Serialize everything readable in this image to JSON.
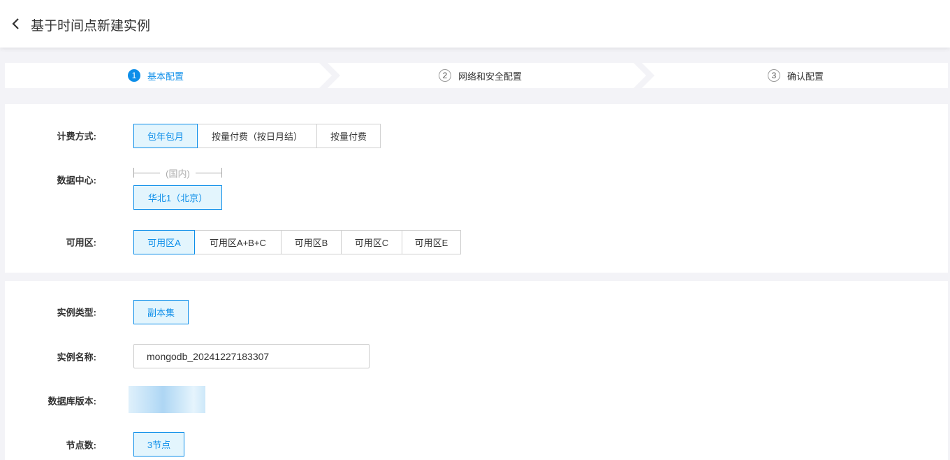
{
  "header": {
    "title": "基于时间点新建实例"
  },
  "steps": [
    {
      "num": "1",
      "label": "基本配置"
    },
    {
      "num": "2",
      "label": "网络和安全配置"
    },
    {
      "num": "3",
      "label": "确认配置"
    }
  ],
  "billing": {
    "label": "计费方式:",
    "options": [
      "包年包月",
      "按量付费（按日月结）",
      "按量付费"
    ]
  },
  "datacenter": {
    "label": "数据中心:",
    "region_group": "(国内)",
    "options": [
      "华北1（北京）"
    ]
  },
  "zone": {
    "label": "可用区:",
    "options": [
      "可用区A",
      "可用区A+B+C",
      "可用区B",
      "可用区C",
      "可用区E"
    ]
  },
  "instance_type": {
    "label": "实例类型:",
    "options": [
      "副本集"
    ]
  },
  "instance_name": {
    "label": "实例名称:",
    "value": "mongodb_20241227183307"
  },
  "db_version": {
    "label": "数据库版本:"
  },
  "nodes": {
    "label": "节点数:",
    "options": [
      "3节点"
    ]
  },
  "colors": {
    "accent": "#0d8ee9",
    "selected_bg": "#e3f5fd",
    "page_bg": "#f3f3f7"
  }
}
